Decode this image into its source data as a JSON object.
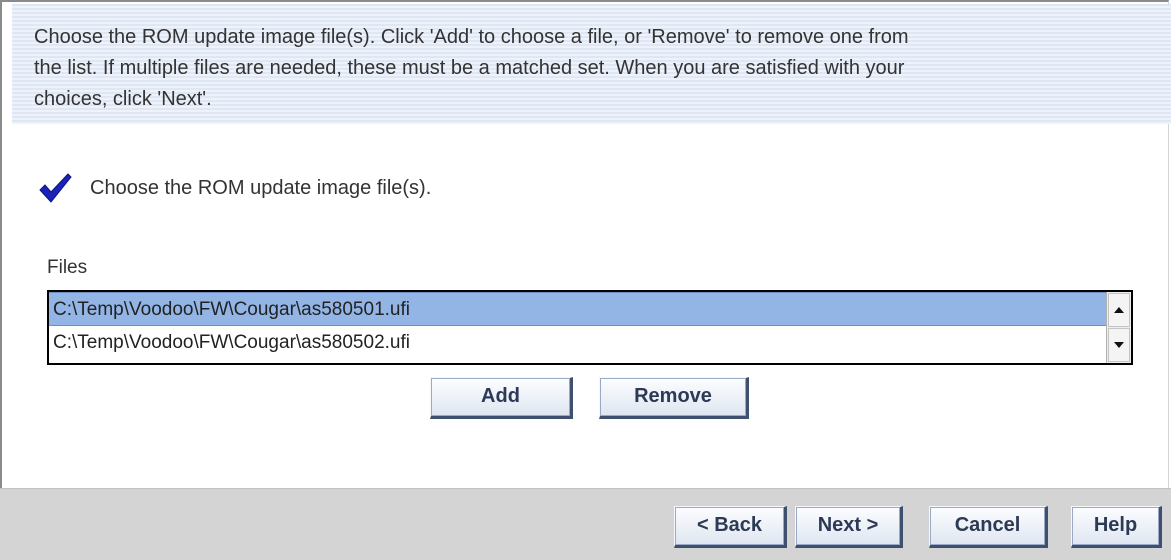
{
  "instructions": {
    "line1": "Choose the ROM update image file(s).  Click 'Add' to choose a file, or 'Remove' to remove one from",
    "line2": "the list.  If multiple files are needed, these must be a matched set.  When you are satisfied with your",
    "line3": "choices, click 'Next'."
  },
  "step": {
    "icon": "checkmark-icon",
    "text": "Choose the ROM update image file(s).",
    "check_color": "#1a22b8"
  },
  "files": {
    "label": "Files",
    "items": [
      "C:\\Temp\\Voodoo\\FW\\Cougar\\as580501.ufi",
      "C:\\Temp\\Voodoo\\FW\\Cougar\\as580502.ufi"
    ],
    "selected_index": 0,
    "selection_color": "#92b5e6"
  },
  "buttons": {
    "add": "Add",
    "remove": "Remove",
    "back": "< Back",
    "next": "Next >",
    "cancel": "Cancel",
    "help": "Help"
  }
}
